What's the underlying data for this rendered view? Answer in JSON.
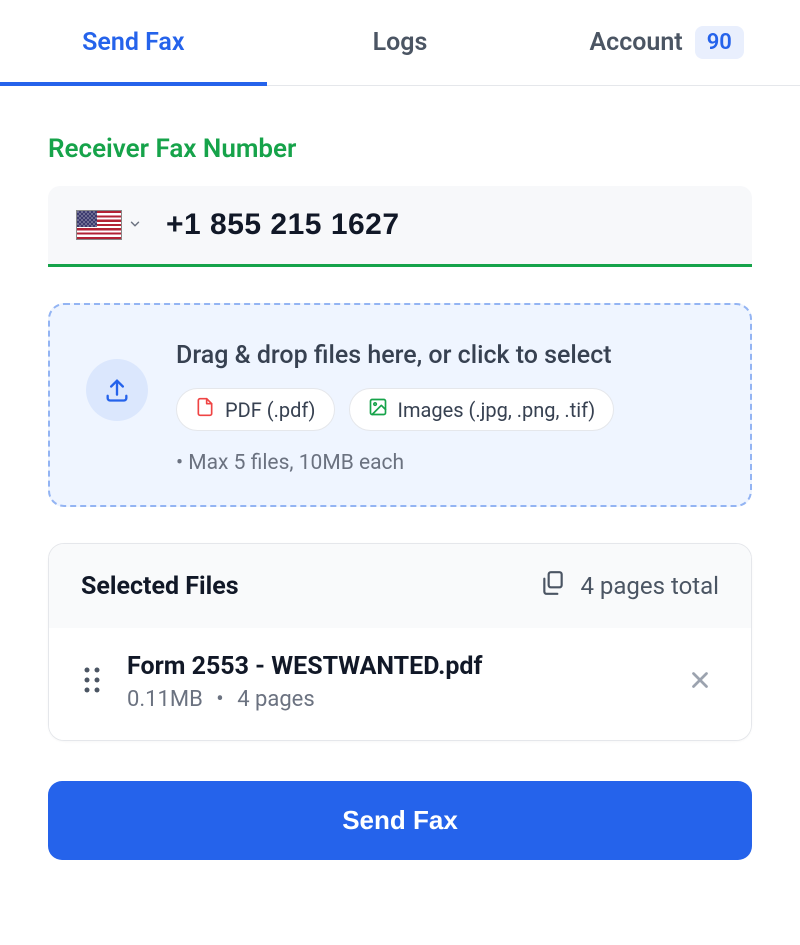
{
  "tabs": {
    "send_fax": "Send Fax",
    "logs": "Logs",
    "account": "Account",
    "account_badge": "90"
  },
  "receiver": {
    "label": "Receiver Fax Number",
    "country": "us",
    "number": "+1 855 215 1627"
  },
  "dropzone": {
    "title": "Drag & drop files here, or click to select",
    "chip_pdf": "PDF (.pdf)",
    "chip_images": "Images (.jpg, .png, .tif)",
    "hint": "• Max 5 files, 10MB each"
  },
  "selected": {
    "title": "Selected Files",
    "pages_total": "4 pages total",
    "files": [
      {
        "name": "Form 2553 - WESTWANTED.pdf",
        "size": "0.11MB",
        "pages": "4 pages"
      }
    ]
  },
  "send_button": "Send Fax"
}
